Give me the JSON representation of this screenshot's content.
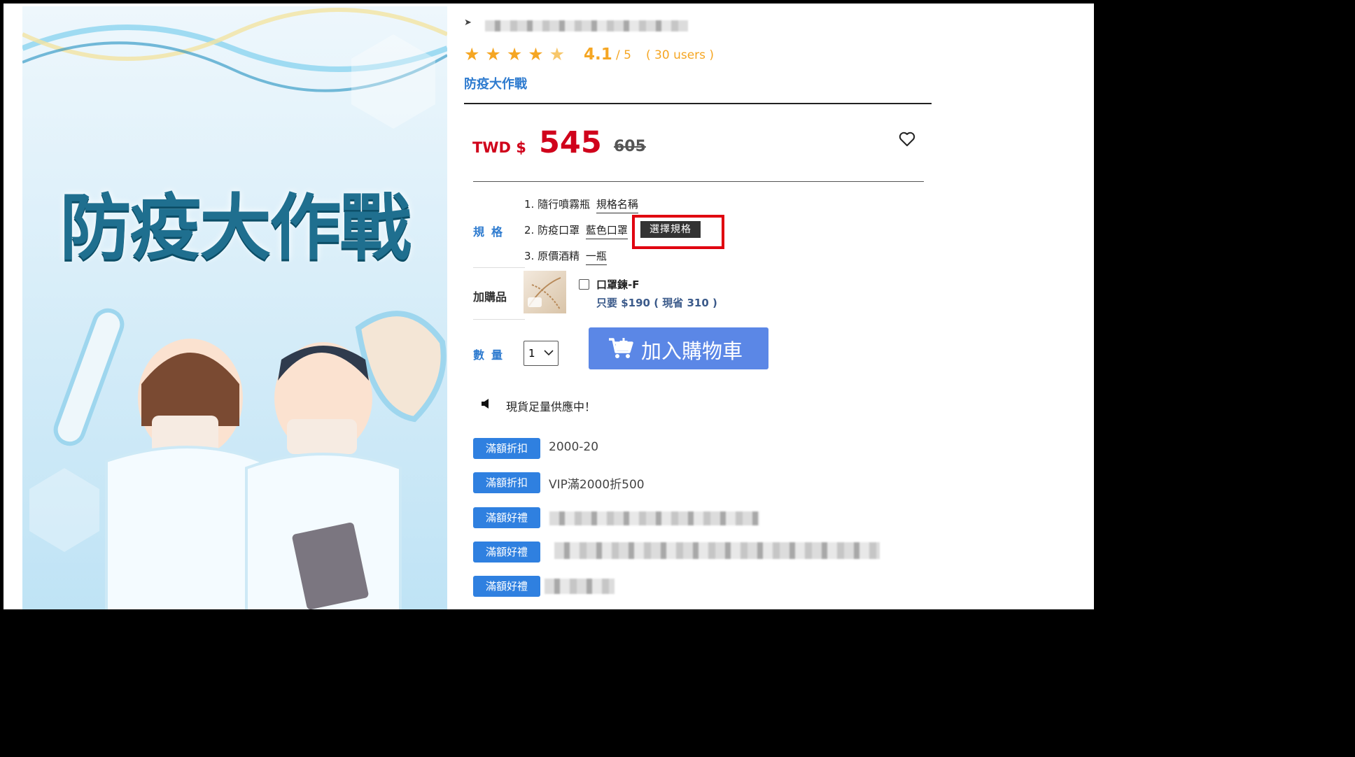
{
  "hero": {
    "title": "防疫大作戰"
  },
  "product": {
    "title": "防疫大作戰",
    "rating": "4.1",
    "rating_max": "/ 5",
    "rating_users": "( 30 users )",
    "currency": "TWD $",
    "price": "545",
    "original_price": "605"
  },
  "spec": {
    "label": "規格",
    "items": [
      {
        "num": "1.",
        "name": "隨行噴霧瓶",
        "value": "規格名稱"
      },
      {
        "num": "2.",
        "name": "防疫口罩",
        "value": "藍色口罩"
      },
      {
        "num": "3.",
        "name": "原價酒精",
        "value": "一瓶"
      }
    ],
    "select_button": "選擇規格"
  },
  "addon": {
    "label": "加購品",
    "name": "口罩鍊-F",
    "price_text": "只要 $190 ( 現省 310 )"
  },
  "quantity": {
    "label": "數量",
    "value": "1"
  },
  "cart": {
    "label": "加入購物車"
  },
  "stock_notice": "現貨足量供應中！",
  "promos": [
    {
      "badge": "滿額折扣",
      "text": "2000-20"
    },
    {
      "badge": "滿額折扣",
      "text": "VIP滿2000折500"
    },
    {
      "badge": "滿額好禮",
      "text": ""
    },
    {
      "badge": "滿額好禮",
      "text": ""
    },
    {
      "badge": "滿額好禮",
      "text": ""
    }
  ],
  "colors": {
    "accent": "#2f80e0",
    "price": "#d0021b",
    "star": "#f5a623",
    "cart": "#5b87e6",
    "highlight": "#e0000f"
  }
}
